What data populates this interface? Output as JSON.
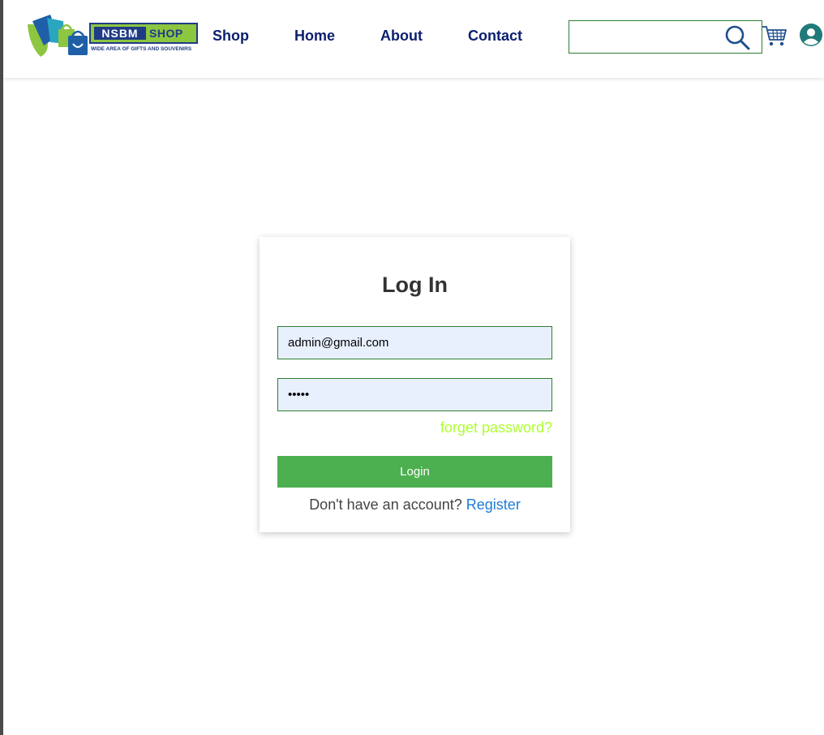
{
  "logo": {
    "brand_primary": "NSBM",
    "brand_secondary": "SHOP",
    "tagline": "WIDE AREA OF GIFTS AND SOUVENIRS"
  },
  "nav": {
    "links": [
      {
        "label": "Shop"
      },
      {
        "label": "Home"
      },
      {
        "label": "About"
      },
      {
        "label": "Contact"
      }
    ]
  },
  "search": {
    "value": "",
    "placeholder": ""
  },
  "icons": {
    "search": "search-icon",
    "cart": "cart-icon",
    "user": "user-icon"
  },
  "login": {
    "title": "Log In",
    "email_value": "admin@gmail.com",
    "password_value": "•••••",
    "forget_label": "forget password?",
    "submit_label": "Login",
    "no_account_text": "Don't have an account?",
    "register_label": "Register"
  },
  "colors": {
    "nav_text": "#0b1f6e",
    "accent_green": "#4caf50",
    "border_green": "#2e7d32",
    "forget_link": "#adff2f",
    "register_link": "#1e7bd6",
    "input_bg": "#e8f0fe",
    "logo_green": "#8dc63f",
    "logo_blue": "#1f3b86"
  }
}
